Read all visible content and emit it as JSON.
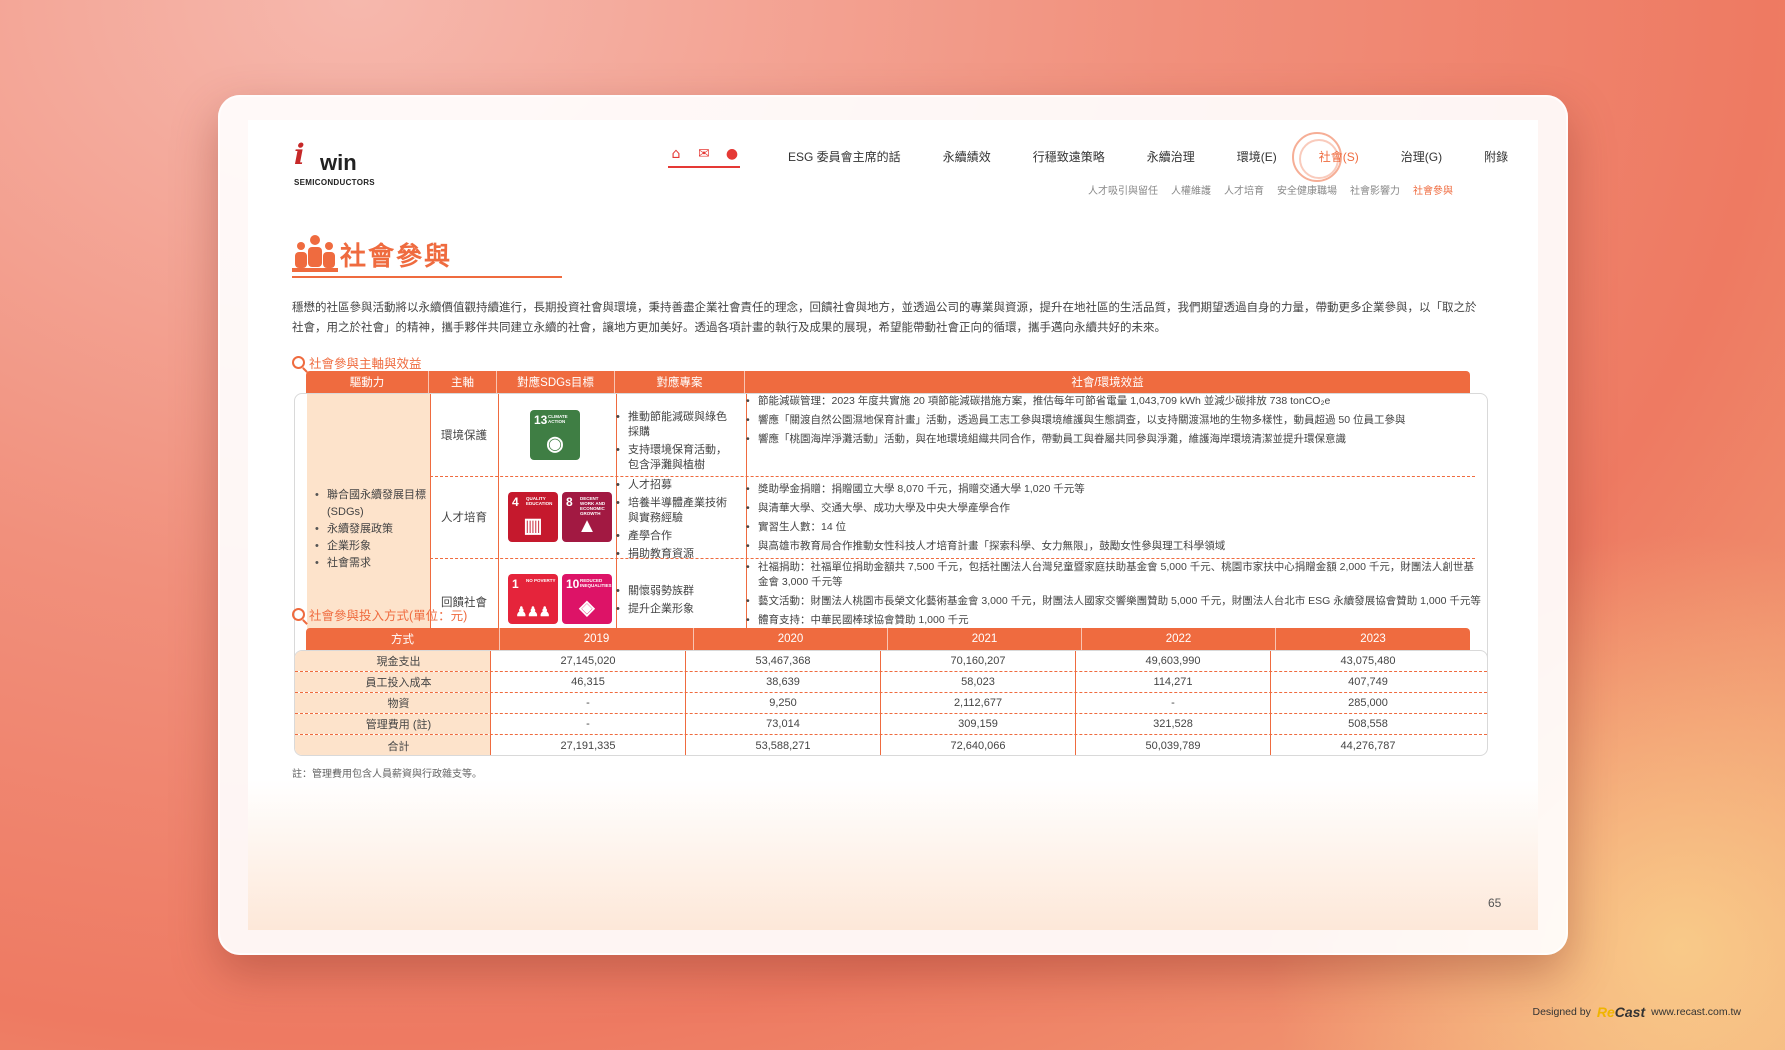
{
  "logo": {
    "mark": "i",
    "word": "win",
    "sub": "SEMICONDUCTORS"
  },
  "quick_icons": [
    "home-icon",
    "mail-icon",
    "dot-icon"
  ],
  "nav": {
    "items": [
      "ESG 委員會主席的話",
      "永續績效",
      "行穩致遠策略",
      "永續治理",
      "環境(E)",
      "社會(S)",
      "治理(G)",
      "附錄"
    ],
    "active": "社會(S)",
    "sub": [
      "人才吸引與留任",
      "人權維護",
      "人才培育",
      "安全健康職場",
      "社會影響力",
      "社會參與"
    ],
    "sub_active": "社會參與"
  },
  "title": "社會參與",
  "intro": "穩懋的社區參與活動將以永續價值觀持續進行，長期投資社會與環境，秉持善盡企業社會責任的理念，回饋社會與地方，並透過公司的專業與資源，提升在地社區的生活品質，我們期望透過自身的力量，帶動更多企業參與，以「取之於社會，用之於社會」的精神，攜手夥伴共同建立永續的社會，讓地方更加美好。透過各項計畫的執行及成果的展現，希望能帶動社會正向的循環，攜手邁向永續共好的未來。",
  "section1": "社會參與主軸與效益",
  "table1": {
    "headers": [
      "驅動力",
      "主軸",
      "對應SDGs目標",
      "對應專案",
      "社會/環境效益"
    ],
    "drivers": [
      "聯合國永續發展目標 (SDGs)",
      "永續發展政策",
      "企業形象",
      "社會需求"
    ],
    "rows": [
      {
        "type": "環境保護",
        "sdgs": [
          {
            "num": "13",
            "label": "CLIMATE ACTION",
            "color": "#3f7e44",
            "glyph": "◉"
          }
        ],
        "projects": [
          "推動節能減碳與綠色採購",
          "支持環境保育活動，包含淨灘與植樹"
        ],
        "benefits": [
          "節能減碳管理：2023 年度共實施 20 項節能減碳措施方案，推估每年可節省電量 1,043,709 kWh 並減少碳排放 738 tonCO₂e",
          "響應「關渡自然公園濕地保育計畫」活動，透過員工志工參與環境維護與生態調查，以支持關渡濕地的生物多樣性，動員超過 50 位員工參與",
          "響應「桃園海岸淨灘活動」活動，與在地環境組織共同合作，帶動員工與眷屬共同參與淨灘，維護海岸環境清潔並提升環保意識"
        ]
      },
      {
        "type": "人才培育",
        "sdgs": [
          {
            "num": "4",
            "label": "QUALITY EDUCATION",
            "color": "#c5192d",
            "glyph": "▥"
          },
          {
            "num": "8",
            "label": "DECENT WORK AND ECONOMIC GROWTH",
            "color": "#a21942",
            "glyph": "▲"
          }
        ],
        "projects": [
          "人才招募",
          "培養半導體產業技術與實務經驗",
          "產學合作",
          "捐助教育資源"
        ],
        "benefits": [
          "獎助學金捐贈：捐贈國立大學 8,070 千元，捐贈交通大學 1,020 千元等",
          "與清華大學、交通大學、成功大學及中央大學產學合作",
          "實習生人數：14 位",
          "與高雄市教育局合作推動女性科技人才培育計畫「探索科學、女力無限」，鼓勵女性參與理工科學領域"
        ]
      },
      {
        "type": "回饋社會",
        "sdgs": [
          {
            "num": "1",
            "label": "NO POVERTY",
            "color": "#e5243b",
            "glyph": "♟♟♟"
          },
          {
            "num": "10",
            "label": "REDUCED INEQUALITIES",
            "color": "#dd1367",
            "glyph": "◈"
          }
        ],
        "projects": [
          "關懷弱勢族群",
          "提升企業形象"
        ],
        "benefits": [
          "社福捐助：社福單位捐助金額共 7,500 千元，包括社團法人台灣兒童暨家庭扶助基金會 5,000 千元、桃園市家扶中心捐贈金額 2,000 千元，財團法人創世基金會 3,000 千元等",
          "藝文活動：財團法人桃園市長榮文化藝術基金會 3,000 千元，財團法人國家交響樂團贊助 5,000 千元，財團法人台北市 ESG 永續發展協會贊助 1,000 千元等",
          "體育支持：中華民國棒球協會贊助 1,000 千元"
        ]
      }
    ]
  },
  "section2": "社會參與投入方式(單位：元)",
  "table2": {
    "headers": [
      "方式",
      "2019",
      "2020",
      "2021",
      "2022",
      "2023"
    ],
    "rows": [
      {
        "label": "現金支出",
        "values": [
          "27,145,020",
          "53,467,368",
          "70,160,207",
          "49,603,990",
          "43,075,480"
        ]
      },
      {
        "label": "員工投入成本",
        "values": [
          "46,315",
          "38,639",
          "58,023",
          "114,271",
          "407,749"
        ]
      },
      {
        "label": "物資",
        "values": [
          "-",
          "9,250",
          "2,112,677",
          "-",
          "285,000"
        ]
      },
      {
        "label": "管理費用 (註)",
        "values": [
          "-",
          "73,014",
          "309,159",
          "321,528",
          "508,558"
        ]
      },
      {
        "label": "合計",
        "values": [
          "27,191,335",
          "53,588,271",
          "72,640,066",
          "50,039,789",
          "44,276,787"
        ]
      }
    ]
  },
  "note": "註：管理費用包含人員薪資與行政雜支等。",
  "page_number": "65",
  "credit": {
    "designed_by": "Designed by",
    "brand_a": "Re",
    "brand_b": "Cast",
    "url": "www.recast.com.tw"
  }
}
